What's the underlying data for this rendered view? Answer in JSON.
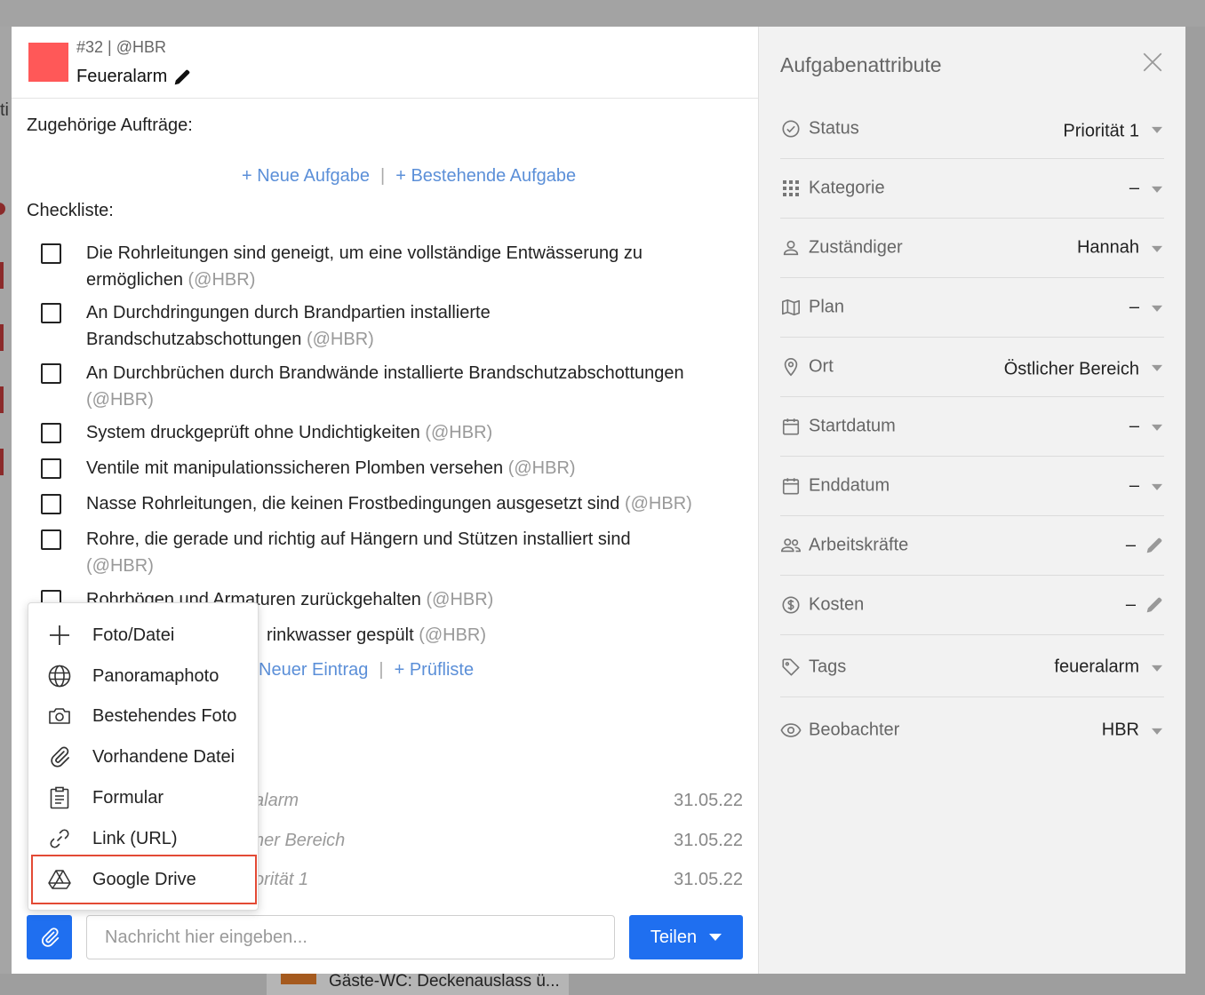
{
  "task": {
    "id_label": "#32 | @HBR",
    "title": "Feueralarm",
    "color": "#ff5858"
  },
  "related": {
    "heading": "Zugehörige Aufträge:",
    "new_task": "+ Neue Aufgabe",
    "separator": "|",
    "existing_task": "+ Bestehende Aufgabe"
  },
  "checklist": {
    "heading": "Checkliste:",
    "items": [
      {
        "text": "Die Rohrleitungen sind geneigt, um eine vollständige Entwässerung zu ermöglichen",
        "by": "(@HBR)"
      },
      {
        "text": "An Durchdringungen durch Brandpartien installierte Brandschutzabschottungen",
        "by": "(@HBR)"
      },
      {
        "text": "An Durchbrüchen durch Brandwände installierte Brandschutzabschottungen",
        "by": "(@HBR)"
      },
      {
        "text": "System druckgeprüft ohne Undichtigkeiten",
        "by": "(@HBR)"
      },
      {
        "text": "Ventile mit manipulationssicheren Plomben versehen",
        "by": "(@HBR)"
      },
      {
        "text": "Nasse Rohrleitungen, die keinen Frostbedingungen ausgesetzt sind",
        "by": "(@HBR)"
      },
      {
        "text": "Rohre, die gerade und richtig auf Hängern und Stützen installiert sind",
        "by": "(@HBR)"
      },
      {
        "text": "Rohrbögen und Armaturen zurückgehalten",
        "by": "(@HBR)"
      },
      {
        "text": "rinkwasser gespült",
        "by": "(@HBR)"
      }
    ],
    "new_entry": "Neuer Eintrag",
    "separator": "|",
    "checklist_add": "+ Prüfliste"
  },
  "feed": [
    {
      "text": "alarm",
      "date": "31.05.22"
    },
    {
      "text": "her Bereich",
      "date": "31.05.22"
    },
    {
      "text": "orität 1",
      "date": "31.05.22"
    }
  ],
  "composer": {
    "placeholder": "Nachricht hier eingeben...",
    "share_label": "Teilen"
  },
  "attach_menu": {
    "items": [
      {
        "label": "Foto/Datei",
        "icon": "plus-icon"
      },
      {
        "label": "Panoramaphoto",
        "icon": "globe-icon"
      },
      {
        "label": "Bestehendes Foto",
        "icon": "camera-icon"
      },
      {
        "label": "Vorhandene Datei",
        "icon": "paperclip-icon"
      },
      {
        "label": "Formular",
        "icon": "clipboard-icon"
      },
      {
        "label": "Link (URL)",
        "icon": "link-icon"
      },
      {
        "label": "Google Drive",
        "icon": "google-drive-icon",
        "highlighted": true
      }
    ],
    "highlight_color": "#e34a35"
  },
  "sidebar": {
    "title": "Aufgabenattribute",
    "attributes": [
      {
        "label": "Status",
        "value": "Priorität 1",
        "icon": "check-circle-icon",
        "control": "dropdown"
      },
      {
        "label": "Kategorie",
        "value": "–",
        "icon": "grid-icon",
        "control": "dropdown"
      },
      {
        "label": "Zuständiger",
        "value": "Hannah",
        "icon": "person-icon",
        "control": "dropdown"
      },
      {
        "label": "Plan",
        "value": "–",
        "icon": "map-icon",
        "control": "dropdown"
      },
      {
        "label": "Ort",
        "value": "Östlicher Bereich",
        "icon": "location-pin-icon",
        "control": "dropdown"
      },
      {
        "label": "Startdatum",
        "value": "–",
        "icon": "calendar-icon",
        "control": "dropdown"
      },
      {
        "label": "Enddatum",
        "value": "–",
        "icon": "calendar-icon",
        "control": "dropdown"
      },
      {
        "label": "Arbeitskräfte",
        "value": "–",
        "icon": "people-icon",
        "control": "edit"
      },
      {
        "label": "Kosten",
        "value": "–",
        "icon": "dollar-circle-icon",
        "control": "edit"
      },
      {
        "label": "Tags",
        "value": "feueralarm",
        "icon": "tag-icon",
        "control": "dropdown"
      },
      {
        "label": "Beobachter",
        "value": "HBR",
        "icon": "eye-icon",
        "control": "dropdown"
      }
    ]
  },
  "background": {
    "left_fragment": "ti",
    "bottom_item": "Gäste-WC: Deckenauslass ü..."
  },
  "colors": {
    "primary": "#1f6ff0",
    "link": "#5b8fd8",
    "sidebar_bg": "#f2f2f2"
  }
}
